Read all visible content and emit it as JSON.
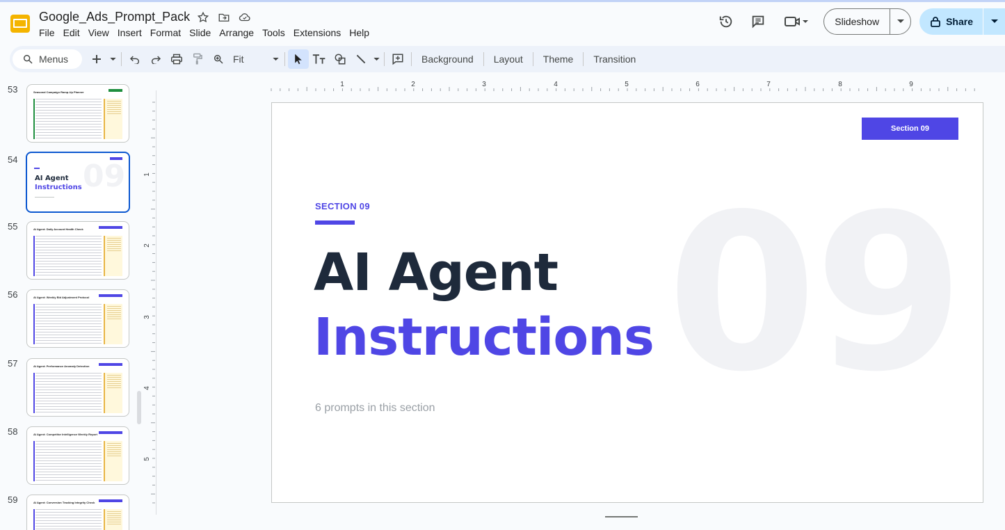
{
  "app": {
    "doc_title": "Google_Ads_Prompt_Pack",
    "menu": [
      "File",
      "Edit",
      "View",
      "Insert",
      "Format",
      "Slide",
      "Arrange",
      "Tools",
      "Extensions",
      "Help"
    ],
    "slideshow_label": "Slideshow",
    "share_label": "Share",
    "accent_color": "#0b57d0"
  },
  "toolbar": {
    "search_label": "Menus",
    "zoom_label": "Fit",
    "background_label": "Background",
    "layout_label": "Layout",
    "theme_label": "Theme",
    "transition_label": "Transition"
  },
  "ruler": {
    "h_ticks": [
      "1",
      "2",
      "3",
      "4",
      "5",
      "6",
      "7",
      "8",
      "9"
    ],
    "v_ticks": [
      "1",
      "2",
      "3",
      "4",
      "5"
    ]
  },
  "filmstrip": {
    "slides": [
      {
        "num": "53",
        "title": "Seasonal Campaign Ramp-Up Planner",
        "accent": "green"
      },
      {
        "num": "54",
        "title": "AI Agent Instructions",
        "selected": true
      },
      {
        "num": "55",
        "title": "AI Agent: Daily Account Health Check",
        "accent": "indigo"
      },
      {
        "num": "56",
        "title": "AI Agent: Weekly Bid Adjustment Protocol",
        "accent": "indigo"
      },
      {
        "num": "57",
        "title": "AI Agent: Performance Anomaly Detection",
        "accent": "indigo"
      },
      {
        "num": "58",
        "title": "AI Agent: Competitor Intelligence Weekly Report",
        "accent": "indigo"
      },
      {
        "num": "59",
        "title": "AI Agent: Conversion Tracking Integrity Check",
        "accent": "indigo"
      }
    ],
    "selected_thumb": {
      "title_line1": "AI Agent",
      "title_line2": "Instructions",
      "big_number": "09"
    }
  },
  "slide": {
    "badge": "Section 09",
    "section_label": "SECTION  09",
    "title_line1": "AI Agent",
    "title_line2": "Instructions",
    "subtitle": "6 prompts in this section",
    "big_number": "09",
    "colors": {
      "accent": "#4f46e5",
      "title": "#1e2a3b",
      "muted": "#9aa0a6"
    }
  }
}
